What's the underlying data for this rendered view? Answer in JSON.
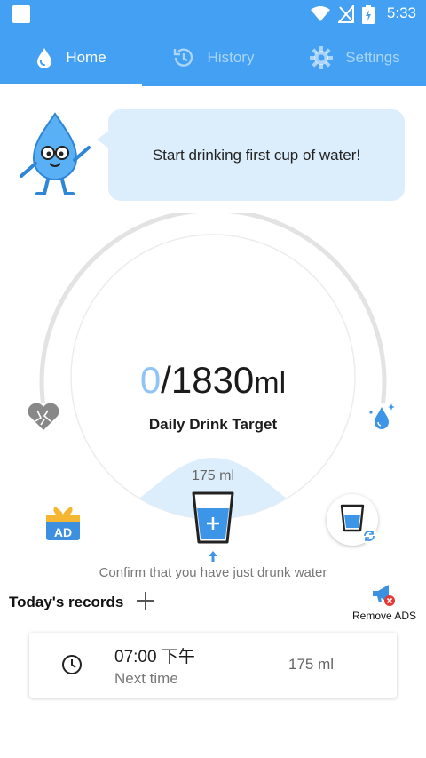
{
  "status_bar": {
    "time": "5:33"
  },
  "tabs": [
    {
      "label": "Home",
      "icon": "water-drop-icon",
      "active": true
    },
    {
      "label": "History",
      "icon": "history-icon",
      "active": false
    },
    {
      "label": "Settings",
      "icon": "gear-icon",
      "active": false
    }
  ],
  "bubble": {
    "text": "Start drinking first cup of water!"
  },
  "progress": {
    "current": "0",
    "target": "/1830",
    "unit": "ml",
    "label": "Daily Drink Target",
    "fraction": 0
  },
  "cup": {
    "size": "175 ml"
  },
  "confirm": {
    "text": "Confirm that you have just drunk water"
  },
  "ad_badge": "AD",
  "records": {
    "title": "Today's records",
    "remove_ads": "Remove ADS",
    "items": [
      {
        "time": "07:00 下午",
        "subtitle": "Next time",
        "amount": "175 ml"
      }
    ]
  },
  "colors": {
    "primary": "#43a0f2",
    "light_blue": "#dceefc",
    "progress_blue": "#8ec4f6",
    "gauge_track": "#e3e3e3"
  }
}
